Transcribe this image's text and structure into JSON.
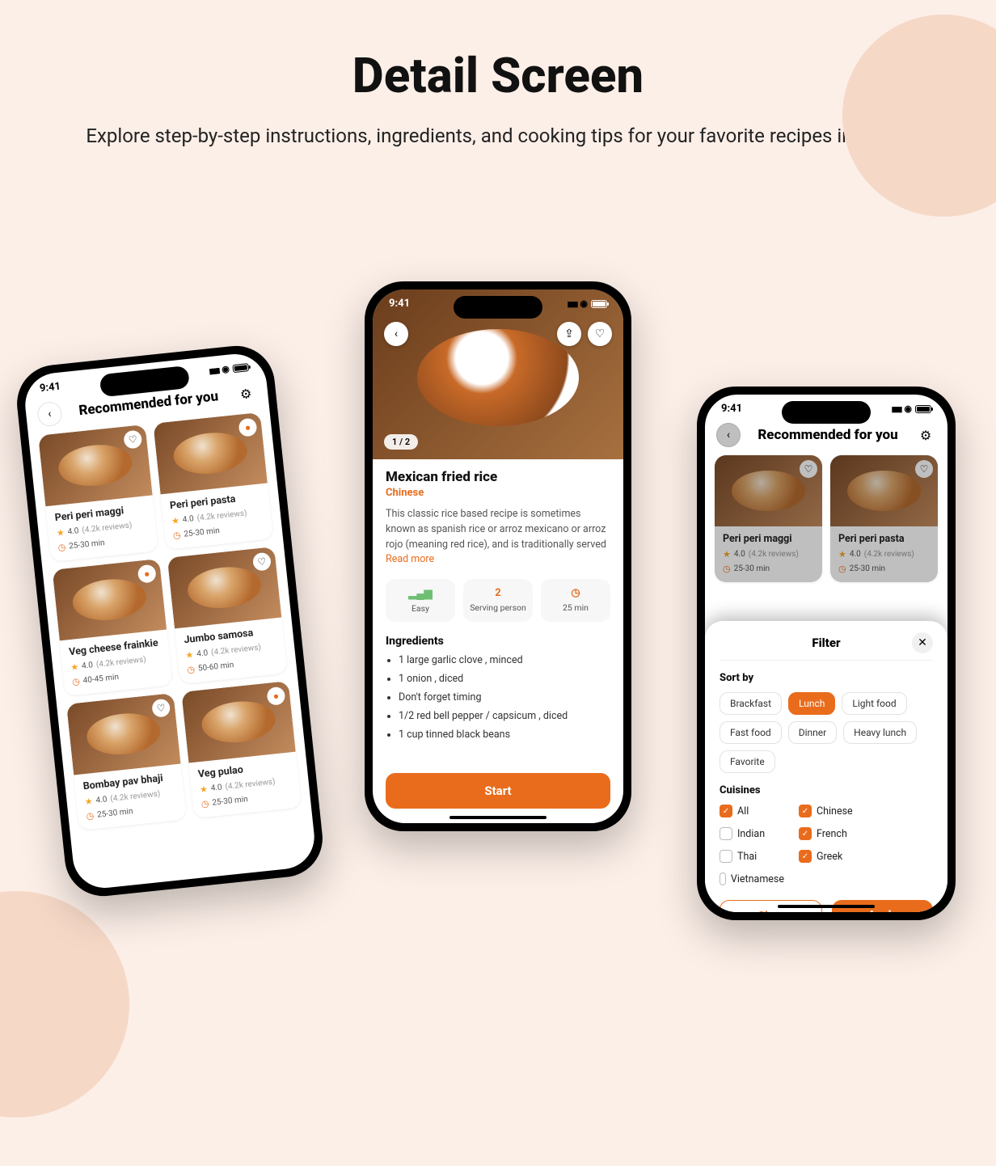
{
  "page": {
    "title": "Detail Screen",
    "subtitle": "Explore step-by-step instructions, ingredients, and cooking tips for your favorite recipes in detail."
  },
  "status": {
    "time": "9:41"
  },
  "phone1": {
    "header": "Recommended for you",
    "cards": [
      {
        "title": "Peri peri maggi",
        "rating": "4.0",
        "reviews": "(4.2k reviews)",
        "time": "25-30 min",
        "fav": false
      },
      {
        "title": "Peri peri pasta",
        "rating": "4.0",
        "reviews": "(4.2k reviews)",
        "time": "25-30 min",
        "fav": true
      },
      {
        "title": "Veg cheese frainkie",
        "rating": "4.0",
        "reviews": "(4.2k reviews)",
        "time": "40-45 min",
        "fav": true
      },
      {
        "title": "Jumbo samosa",
        "rating": "4.0",
        "reviews": "(4.2k reviews)",
        "time": "50-60 min",
        "fav": false
      },
      {
        "title": "Bombay pav bhaji",
        "rating": "4.0",
        "reviews": "(4.2k reviews)",
        "time": "25-30 min",
        "fav": false
      },
      {
        "title": "Veg pulao",
        "rating": "4.0",
        "reviews": "(4.2k reviews)",
        "time": "25-30 min",
        "fav": true
      }
    ]
  },
  "phone2": {
    "pager": "1 / 2",
    "name": "Mexican fried rice",
    "cuisine": "Chinese",
    "desc": "This classic rice based recipe is sometimes known as spanish rice or arroz mexicano or arroz rojo (meaning red rice), and is traditionally served ",
    "readmore": "Read more",
    "tiles": {
      "difficulty_val": "▂▄▆",
      "difficulty_lbl": "Easy",
      "serving_val": "2",
      "serving_lbl": "Serving person",
      "time_val": "25 min",
      "time_icon": "◷"
    },
    "ingredients_h": "Ingredients",
    "ingredients": [
      "1 large garlic clove , minced",
      "1 onion , diced",
      "Don't forget timing",
      "1/2 red bell pepper / capsicum , diced",
      "1 cup tinned black beans"
    ],
    "start": "Start"
  },
  "phone3": {
    "header": "Recommended for you",
    "cards": [
      {
        "title": "Peri peri maggi",
        "rating": "4.0",
        "reviews": "(4.2k reviews)",
        "time": "25-30 min"
      },
      {
        "title": "Peri peri pasta",
        "rating": "4.0",
        "reviews": "(4.2k reviews)",
        "time": "25-30 min"
      }
    ],
    "filter": {
      "title": "Filter",
      "sort_label": "Sort by",
      "sort_opts": [
        {
          "label": "Brackfast",
          "on": false
        },
        {
          "label": "Lunch",
          "on": true
        },
        {
          "label": "Light food",
          "on": false
        },
        {
          "label": "Fast food",
          "on": false
        },
        {
          "label": "Dinner",
          "on": false
        },
        {
          "label": "Heavy lunch",
          "on": false
        },
        {
          "label": "Favorite",
          "on": false
        }
      ],
      "cuisines_label": "Cuisines",
      "cuisines": [
        {
          "label": "All",
          "on": true
        },
        {
          "label": "Chinese",
          "on": true
        },
        {
          "label": "Indian",
          "on": false
        },
        {
          "label": "French",
          "on": true
        },
        {
          "label": "Thai",
          "on": false
        },
        {
          "label": "Greek",
          "on": true
        },
        {
          "label": "Vietnamese",
          "on": false
        }
      ],
      "clear": "Clear",
      "apply": "Apply"
    }
  }
}
